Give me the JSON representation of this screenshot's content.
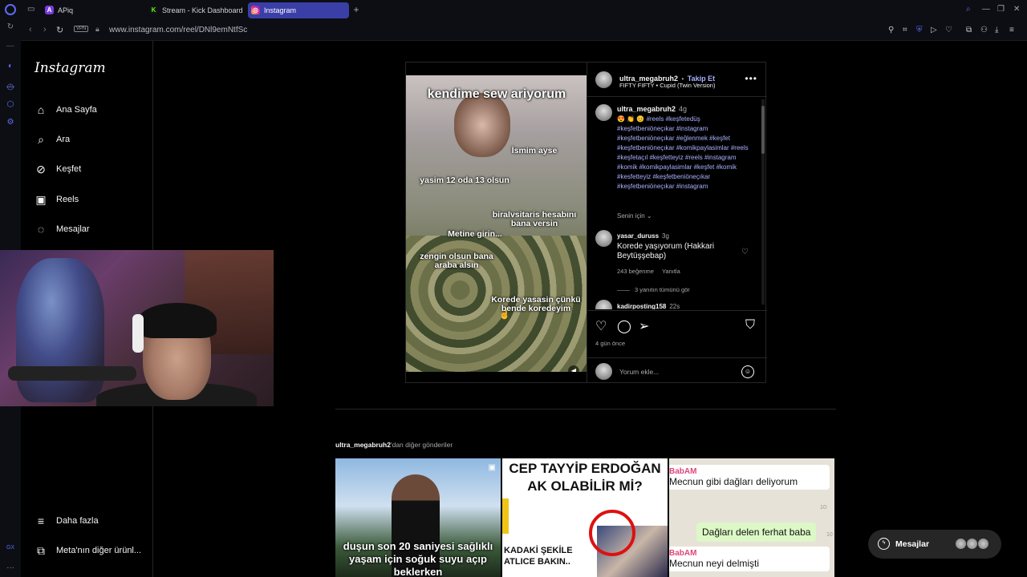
{
  "browser": {
    "tabs": [
      {
        "label": "APiq",
        "icon": "apiq-icon"
      },
      {
        "label": "Stream - Kick Dashboard",
        "icon": "kick-icon"
      },
      {
        "label": "Instagram",
        "icon": "instagram-icon"
      }
    ],
    "vpn_label": "VPN",
    "url": "www.instagram.com/reel/DNl9emNtfSc"
  },
  "instagram": {
    "logo": "Instagram",
    "nav": [
      {
        "label": "Ana Sayfa",
        "icon": "home-icon"
      },
      {
        "label": "Ara",
        "icon": "search-icon"
      },
      {
        "label": "Keşfet",
        "icon": "compass-icon"
      },
      {
        "label": "Reels",
        "icon": "reels-icon"
      },
      {
        "label": "Mesajlar",
        "icon": "messenger-icon"
      }
    ],
    "nav_bottom": [
      {
        "label": "Daha fazla",
        "icon": "menu-icon"
      },
      {
        "label": "Meta'nın diğer ürünl...",
        "icon": "meta-apps-icon"
      }
    ]
  },
  "post": {
    "video_texts": {
      "title": "kendime sew ariyorum",
      "t1": "İsmim ayse",
      "t2": "yasim 12 oda 13 olsun",
      "t3": "biralvsitaris hesabını bana versin",
      "t4": "Metine girin...",
      "t5": "zengin olsun bana araba alsın",
      "t6": "Korede yasasin çünkü bende koredeyim"
    },
    "author": "ultra_megabruh2",
    "separator": "•",
    "follow_label": "Takip Et",
    "song": "FIFTY FIFTY • Cupid (Twin Version)",
    "caption": {
      "author": "ultra_megabruh2",
      "time": "4g",
      "emojis": "😍 👏 😊",
      "hashtags": "#reels #keşfetedüş #keşfetbeniöneçıkar #instagram #keşfetbeniöneçıkar #eğlenmek #keşfet #keşfetbeniöneçıkar #komikpaylasimlar #reels #keşfetaçıl #keşfetteyiz #reels #instagram #komik #komikpaylasimlar #keşfet #komik #kesfetteyiz #keşfetbeniöneçıkar #keşfetbeniöneçıkar #instagram"
    },
    "senin_icin": "Senin için",
    "comment1": {
      "author": "yasar_duruss",
      "time": "3g",
      "text": "Korede yaşıyorum (Hakkari Beytüşşebap)",
      "likes": "243 beğenme",
      "reply": "Yanıtla",
      "view_replies": "3 yanıtın tümünü gör"
    },
    "comment2": {
      "author": "kadirposting158",
      "time": "22s"
    },
    "date": "4 gün önce",
    "comment_placeholder": "Yorum ekle..."
  },
  "more_posts": {
    "author": "ultra_megabruh2",
    "suffix": "'dan diğer gönderiler",
    "thumb1_caption": "duşun son 20 saniyesi sağlıklı yaşam için soğuk suyu açıp beklerken",
    "thumb2_header": "CEP TAYYİP ERDOĞAN AK OLABİLİR Mİ?",
    "thumb2_bottom": "KADAKİ ŞEKİLE ATLICE BAKIN..",
    "thumb3_name1": "BabAM",
    "thumb3_msg1": "Mecnun gibi dağları deliyorum",
    "thumb3_time1": "10:",
    "thumb3_msg2": "Dağları delen ferhat baba",
    "thumb3_time2": "10",
    "thumb3_name2": "BabAM",
    "thumb3_msg3": "Mecnun neyi delmişti"
  },
  "messenger": {
    "label": "Mesajlar"
  },
  "colors": {
    "accent": "#3a3fa8",
    "link": "#a9b1ff",
    "ig_bg": "#000000"
  }
}
